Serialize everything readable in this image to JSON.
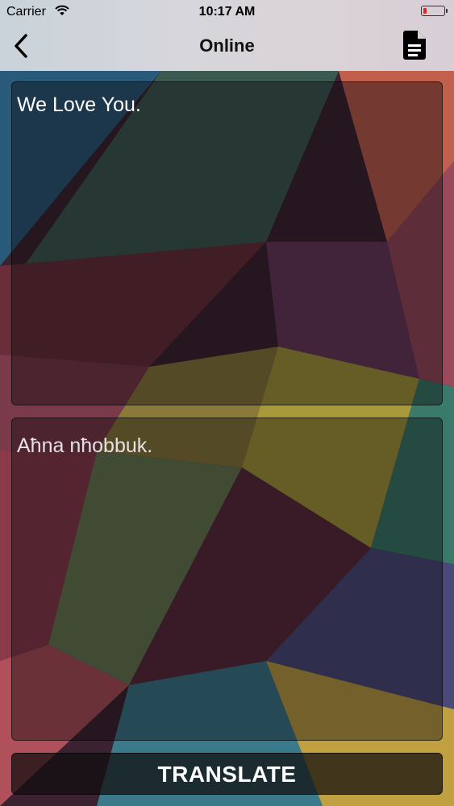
{
  "status_bar": {
    "carrier": "Carrier",
    "time": "10:17 AM",
    "battery_level": 0.1
  },
  "nav": {
    "title": "Online",
    "back_icon": "chevron-left-icon",
    "action_icon": "document-icon"
  },
  "input": {
    "text": "We Love You."
  },
  "output": {
    "text": "Aħna nħobbuk."
  },
  "translate_button": {
    "label": "TRANSLATE"
  },
  "colors": {
    "battery_low": "#e0262b",
    "text": "#ffffff",
    "header_text": "#111111"
  }
}
